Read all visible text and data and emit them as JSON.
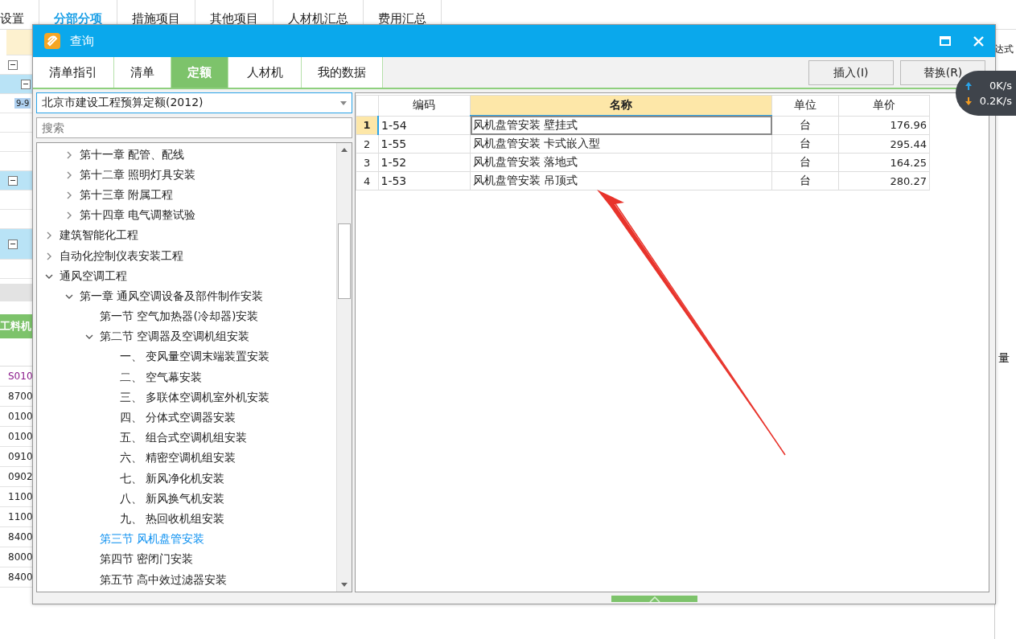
{
  "app_tabs": [
    {
      "label": "设置",
      "selected": false
    },
    {
      "label": "分部分项",
      "selected": true
    },
    {
      "label": "措施项目",
      "selected": false
    },
    {
      "label": "其他项目",
      "selected": false
    },
    {
      "label": "人材机汇总",
      "selected": false
    },
    {
      "label": "费用汇总",
      "selected": false
    }
  ],
  "background": {
    "grid_cell": "9-9",
    "header_fragment": "达式",
    "panel_title": "工料机",
    "quantity_fragment": "量",
    "codes": [
      {
        "text": "S010",
        "kind": "material"
      },
      {
        "text": "8700",
        "kind": "plain"
      },
      {
        "text": "0100",
        "kind": "plain"
      },
      {
        "text": "0100",
        "kind": "plain"
      },
      {
        "text": "0910",
        "kind": "plain"
      },
      {
        "text": "0902",
        "kind": "plain"
      },
      {
        "text": "1100",
        "kind": "plain"
      },
      {
        "text": "1100",
        "kind": "plain"
      },
      {
        "text": "8400",
        "kind": "plain"
      },
      {
        "text": "8000",
        "kind": "plain"
      },
      {
        "text": "8400",
        "kind": "plain"
      }
    ]
  },
  "dialog": {
    "title": "查询",
    "tabs": [
      {
        "label": "清单指引",
        "selected": false
      },
      {
        "label": "清单",
        "selected": false
      },
      {
        "label": "定额",
        "selected": true
      },
      {
        "label": "人材机",
        "selected": false
      },
      {
        "label": "我的数据",
        "selected": false
      }
    ],
    "buttons": [
      "插入(I)",
      "替换(R)"
    ],
    "library_select": {
      "value": "北京市建设工程预算定额(2012)"
    },
    "search": {
      "placeholder": "搜索"
    },
    "tree": [
      {
        "children": [
          {
            "label": "第十一章 配管、配线",
            "expanded": false,
            "selected": false
          },
          {
            "label": "第十二章 照明灯具安装",
            "expanded": false,
            "selected": false
          },
          {
            "label": "第十三章 附属工程",
            "expanded": false,
            "selected": false
          },
          {
            "label": "第十四章 电气调整试验",
            "expanded": false,
            "selected": false
          }
        ]
      },
      {
        "label": "建筑智能化工程",
        "expanded": false,
        "selected": false
      },
      {
        "label": "自动化控制仪表安装工程",
        "expanded": false,
        "selected": false
      },
      {
        "label": "通风空调工程",
        "expanded": true,
        "selected": false,
        "children": [
          {
            "label": "第一章 通风空调设备及部件制作安装",
            "expanded": true,
            "selected": false,
            "children": [
              {
                "label": "第一节 空气加热器(冷却器)安装",
                "selected": false
              },
              {
                "label": "第二节 空调器及空调机组安装",
                "expanded": true,
                "selected": false,
                "children": [
                  {
                    "label": "一、 变风量空调末端装置安装",
                    "selected": false
                  },
                  {
                    "label": "二、 空气幕安装",
                    "selected": false
                  },
                  {
                    "label": "三、 多联体空调机室外机安装",
                    "selected": false
                  },
                  {
                    "label": "四、 分体式空调器安装",
                    "selected": false
                  },
                  {
                    "label": "五、 组合式空调机组安装",
                    "selected": false
                  },
                  {
                    "label": "六、 精密空调机组安装",
                    "selected": false
                  },
                  {
                    "label": "七、 新风净化机安装",
                    "selected": false
                  },
                  {
                    "label": "八、 新风换气机安装",
                    "selected": false
                  },
                  {
                    "label": "九、 热回收机组安装",
                    "selected": false
                  }
                ]
              },
              {
                "label": "第三节 风机盘管安装",
                "selected": true
              },
              {
                "label": "第四节 密闭门安装",
                "selected": false
              },
              {
                "label": "第五节 高中效过滤器安装",
                "selected": false
              }
            ]
          }
        ]
      }
    ],
    "table": {
      "columns": [
        {
          "label": "编码",
          "selected": false
        },
        {
          "label": "名称",
          "selected": true
        },
        {
          "label": "单位",
          "selected": false
        },
        {
          "label": "单价",
          "selected": false
        }
      ],
      "rows": [
        {
          "index": "1",
          "code": "1-54",
          "name": "风机盘管安装 壁挂式",
          "unit": "台",
          "price": "176.96",
          "selected": true
        },
        {
          "index": "2",
          "code": "1-55",
          "name": "风机盘管安装 卡式嵌入型",
          "unit": "台",
          "price": "295.44",
          "selected": false
        },
        {
          "index": "3",
          "code": "1-52",
          "name": "风机盘管安装 落地式",
          "unit": "台",
          "price": "164.25",
          "selected": false
        },
        {
          "index": "4",
          "code": "1-53",
          "name": "风机盘管安装 吊顶式",
          "unit": "台",
          "price": "280.27",
          "selected": false
        }
      ]
    }
  },
  "network_widget": {
    "upload": "0K/s",
    "download": "0.2K/s"
  }
}
